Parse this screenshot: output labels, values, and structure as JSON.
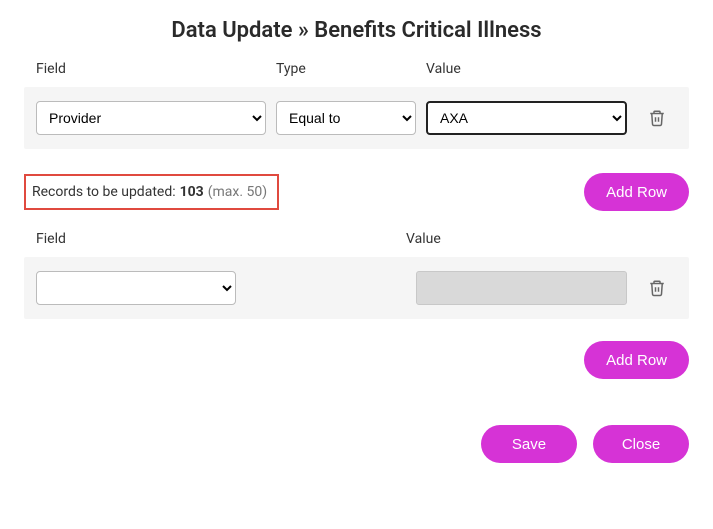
{
  "title": "Data Update » Benefits Critical Illness",
  "filter": {
    "headers": {
      "field": "Field",
      "type": "Type",
      "value": "Value"
    },
    "row": {
      "field": "Provider",
      "type": "Equal to",
      "value": "AXA"
    }
  },
  "status": {
    "label": "Records to be updated:",
    "count": "103",
    "max": "(max. 50)"
  },
  "buttons": {
    "add_row": "Add Row",
    "save": "Save",
    "close": "Close"
  },
  "update": {
    "headers": {
      "field": "Field",
      "value": "Value"
    },
    "row": {
      "field": "",
      "value": ""
    }
  }
}
